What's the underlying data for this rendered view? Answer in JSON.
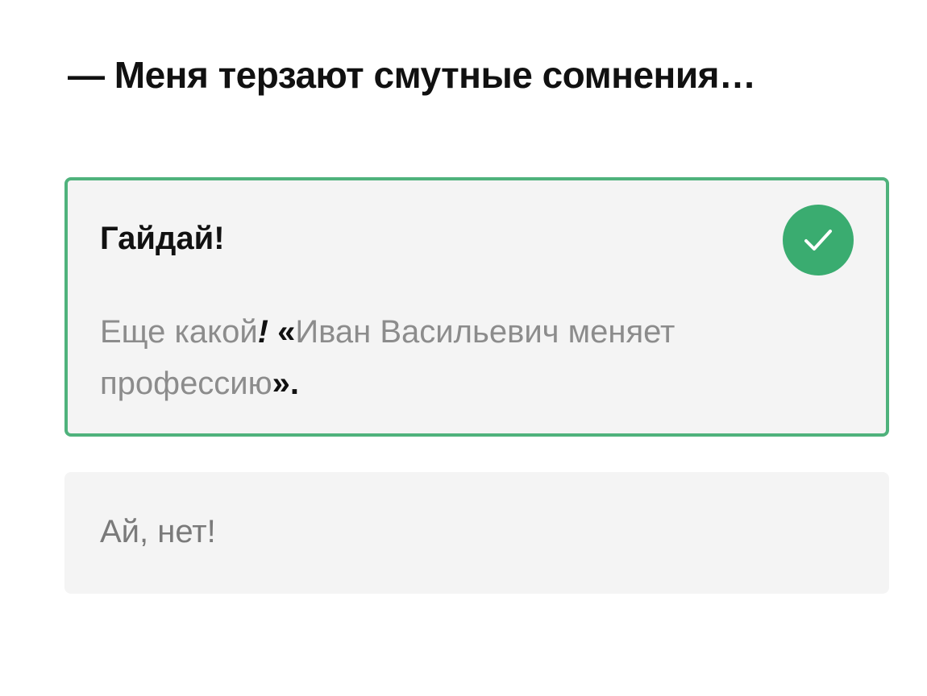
{
  "question": {
    "text": "— Меня терзают смутные сомнения…"
  },
  "options": [
    {
      "title": "Гайдай!",
      "state": "correct",
      "status_icon": "check-circle-icon",
      "explanation": {
        "part1": "Еще какой",
        "exclaim": "!",
        "space": " ",
        "open_quote": "«",
        "film": "Иван Васильевич меняет профессию",
        "close_quote": "»",
        "period": "."
      }
    },
    {
      "label": "Ай, нет!",
      "state": "unselected"
    }
  ],
  "colors": {
    "correct_border": "#4fb27c",
    "check_fill": "#3aac70",
    "card_background": "#f4f4f4",
    "muted_text": "#8c8c8c"
  }
}
